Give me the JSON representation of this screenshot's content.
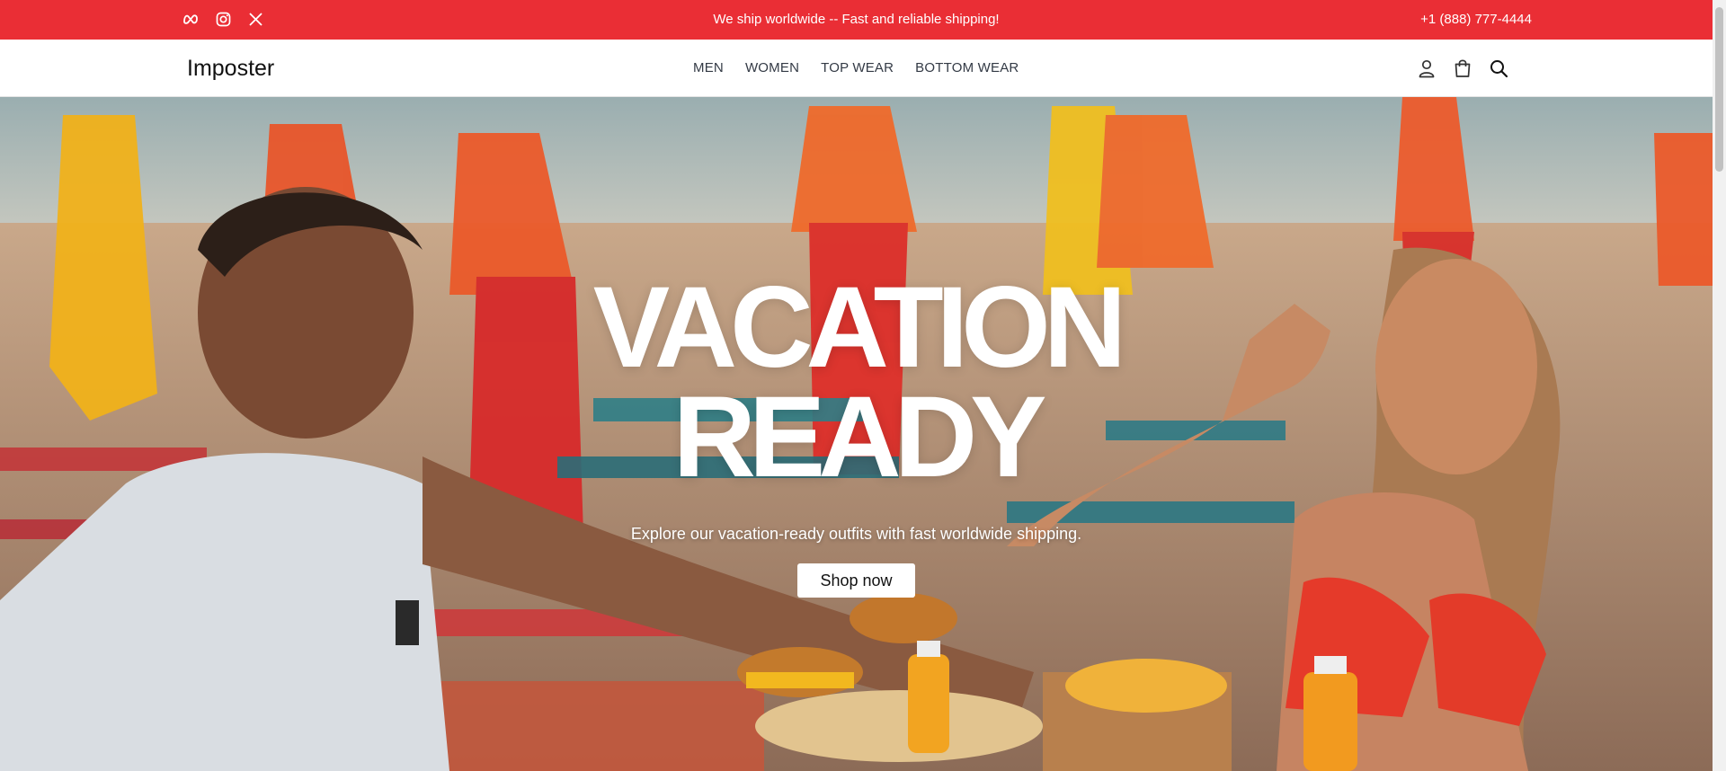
{
  "topbar": {
    "social_icons": [
      "meta-icon",
      "instagram-icon",
      "x-icon"
    ],
    "announcement": "We ship worldwide -- Fast and reliable shipping!",
    "phone": "+1 (888) 777-4444",
    "background_color": "#ea2e35"
  },
  "navbar": {
    "brand": "Imposter",
    "links": [
      "MEN",
      "WOMEN",
      "TOP WEAR",
      "BOTTOM WEAR"
    ],
    "action_icons": [
      "user-icon",
      "shopping-bag-icon",
      "search-icon"
    ]
  },
  "hero": {
    "title_line1": "VACATION",
    "title_line2": "READY",
    "subtitle": "Explore our vacation-ready outfits with fast worldwide shipping.",
    "cta_label": "Shop now"
  }
}
